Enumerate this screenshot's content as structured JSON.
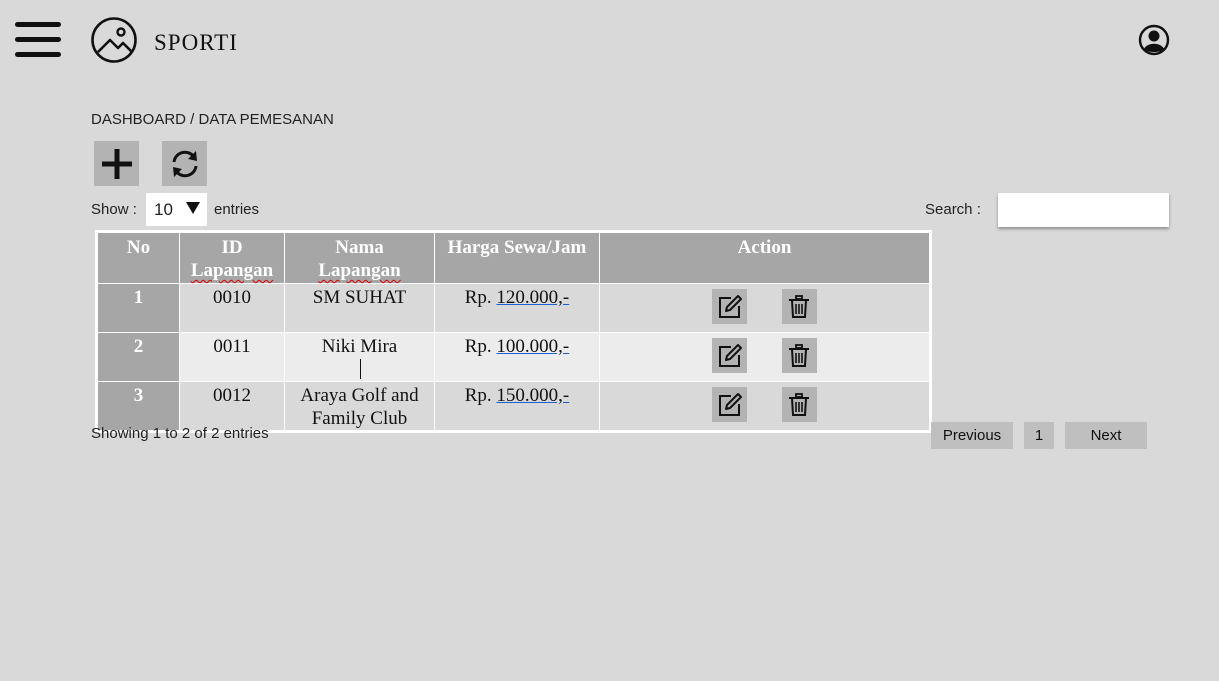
{
  "app": {
    "brand": "SPORTI"
  },
  "icons": {
    "menu": "hamburger-menu-icon",
    "logo": "image-logo-icon",
    "user": "user-account-icon",
    "add": "plus-icon",
    "refresh": "refresh-icon",
    "edit": "edit-icon",
    "delete": "trash-icon"
  },
  "breadcrumb": "DASHBOARD / DATA PEMESANAN",
  "controls": {
    "show_label": "Show :",
    "entries_value": "10",
    "entries_label": "entries",
    "search_label": "Search :",
    "search_value": ""
  },
  "table": {
    "headers": {
      "no": "No",
      "id_line1": "ID",
      "id_line2": "Lapangan",
      "nama_line1": "Nama",
      "nama_line2": "Lapangan",
      "harga": "Harga Sewa/Jam",
      "action": "Action"
    },
    "rows": [
      {
        "no": "1",
        "id": "0010",
        "name_line1": "SM SUHAT",
        "name_line2": "",
        "price_prefix": "Rp.",
        "price_value": "120.000,-"
      },
      {
        "no": "2",
        "id": "0011",
        "name_line1": "Niki Mira",
        "name_line2": "",
        "price_prefix": "Rp.",
        "price_value": "100.000,-"
      },
      {
        "no": "3",
        "id": "0012",
        "name_line1": "Araya Golf and",
        "name_line2": "Family Club",
        "price_prefix": "Rp.",
        "price_value": "150.000,-"
      }
    ]
  },
  "footer": {
    "info": "Showing 1 to 2 of 2 entries",
    "previous": "Previous",
    "page": "1",
    "next": "Next"
  }
}
